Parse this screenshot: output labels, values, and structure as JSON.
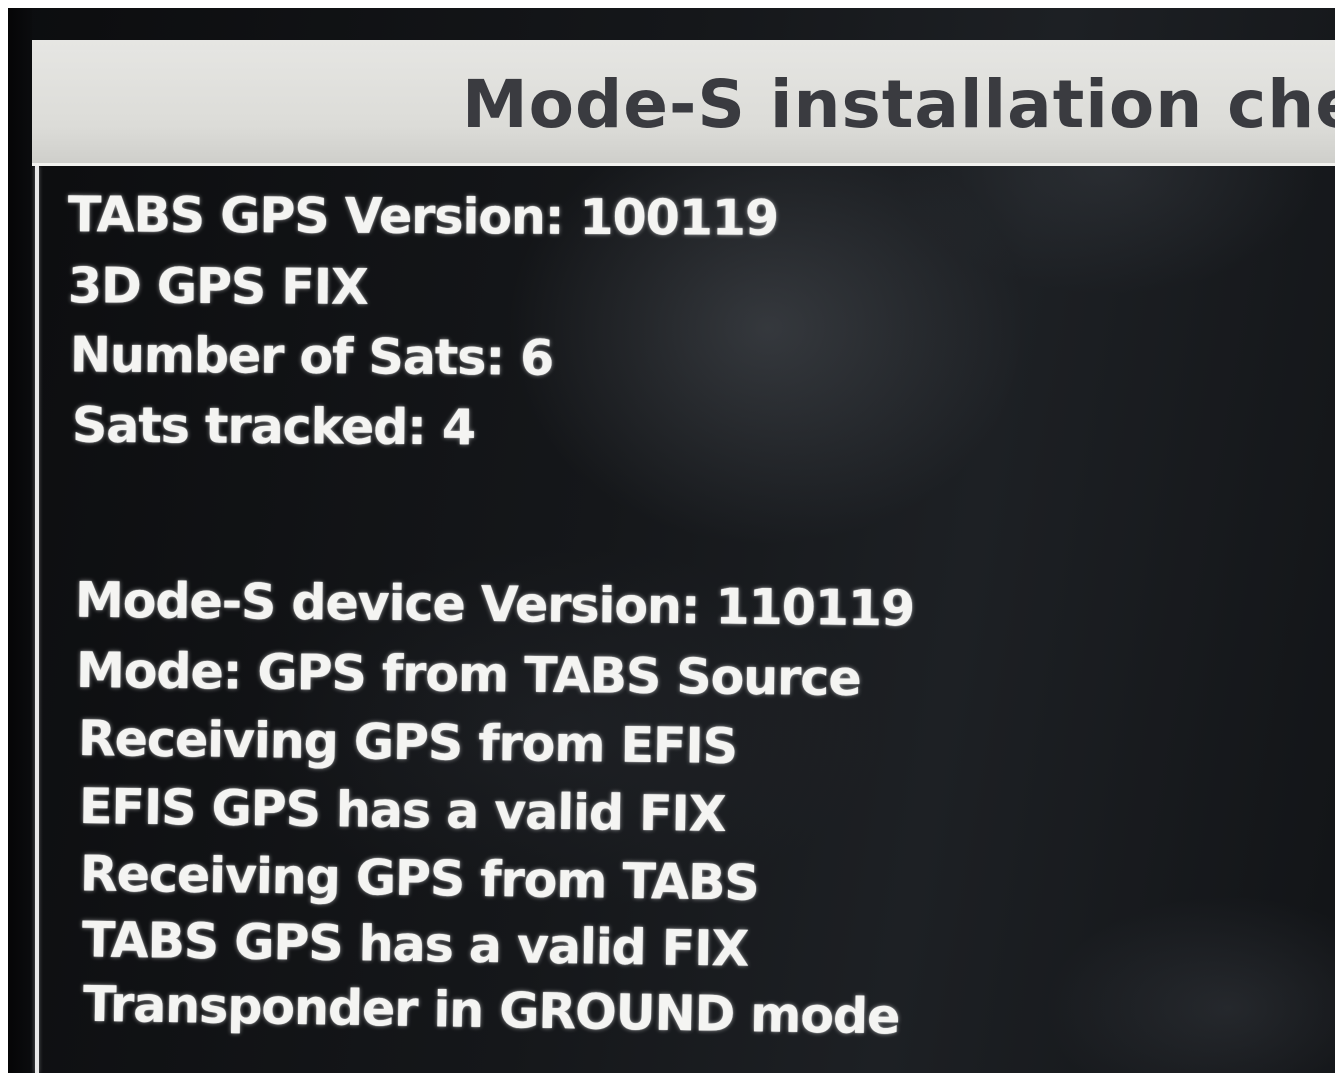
{
  "window": {
    "title": "Mode-S installation checks"
  },
  "gps": {
    "version": "TABS GPS Version: 100119",
    "fix": "3D GPS FIX",
    "num_sats": "Number of Sats: 6",
    "sats_tracked": "Sats tracked: 4"
  },
  "mode_s": {
    "device_version": "Mode-S device Version: 110119",
    "mode": "Mode: GPS from TABS Source",
    "receiving_efis": "Receiving GPS from EFIS",
    "efis_valid_fix": "EFIS GPS has a valid FIX",
    "receiving_tabs": "Receiving GPS from TABS",
    "tabs_valid_fix": "TABS GPS has a valid FIX",
    "transponder_mode": "Transponder in GROUND mode"
  }
}
